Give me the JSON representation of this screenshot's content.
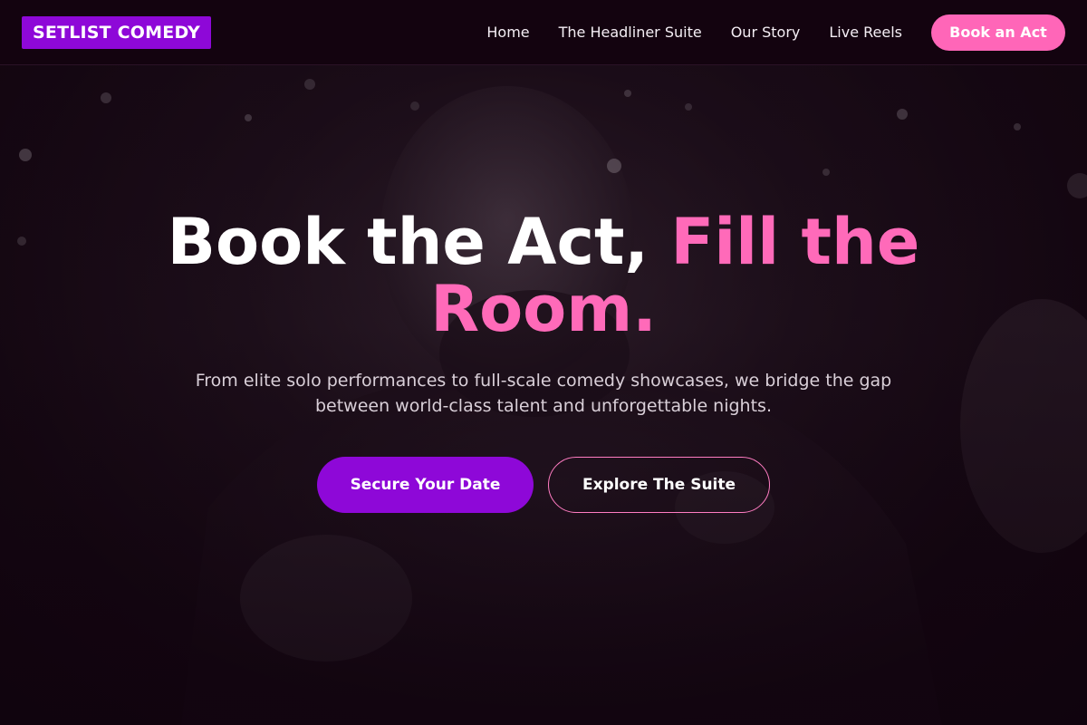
{
  "brand": {
    "name": "SETLIST COMEDY"
  },
  "nav": {
    "links": [
      {
        "label": "Home"
      },
      {
        "label": "The Headliner Suite"
      },
      {
        "label": "Our Story"
      },
      {
        "label": "Live Reels"
      }
    ],
    "cta_label": "Book an Act"
  },
  "hero": {
    "headline_part1": "Book the Act, ",
    "headline_part2": "Fill the Room.",
    "subtitle": "From elite solo performances to full-scale comedy showcases, we bridge the gap between world-class talent and unforgettable nights.",
    "primary_cta": "Secure Your Date",
    "secondary_cta": "Explore The Suite"
  },
  "colors": {
    "brand_purple": "#8e08d8",
    "accent_pink": "#ff66b8",
    "background": "#12040f"
  },
  "icons": [
    "comedian-photo-background"
  ]
}
